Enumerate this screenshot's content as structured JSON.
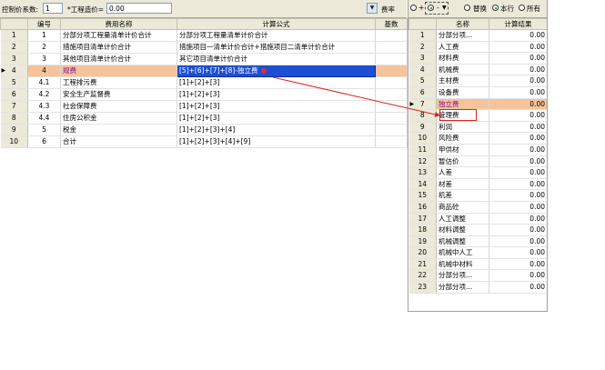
{
  "left_toolbar": {
    "coef_label": "控制价系数:",
    "coef_value": "1",
    "price_label": "*工程造价=",
    "price_value": "0.00",
    "rate_label": "费率"
  },
  "left_table": {
    "headers": [
      "",
      "编号",
      "费用名称",
      "计算公式",
      "基数"
    ],
    "rows": [
      {
        "row": "1",
        "code": "1",
        "name": "分部分项工程量清单计价合计",
        "formula": "分部分项工程量清单计价合计"
      },
      {
        "row": "2",
        "code": "2",
        "name": "措施项目清单计价合计",
        "formula": "措施项目一清单计价合计+措施项目二清单计价合计"
      },
      {
        "row": "3",
        "code": "3",
        "name": "其他项目清单计价合计",
        "formula": "其它项目清单计价合计"
      },
      {
        "row": "4",
        "code": "4",
        "name": "规费",
        "formula": "[5]+[6]+[7]+[8]-独立费"
      },
      {
        "row": "5",
        "code": "4.1",
        "name": "工程排污费",
        "formula": "[1]+[2]+[3]"
      },
      {
        "row": "6",
        "code": "4.2",
        "name": "安全生产监督费",
        "formula": "[1]+[2]+[3]"
      },
      {
        "row": "7",
        "code": "4.3",
        "name": "社会保障费",
        "formula": "[1]+[2]+[3]"
      },
      {
        "row": "8",
        "code": "4.4",
        "name": "住房公积金",
        "formula": "[1]+[2]+[3]"
      },
      {
        "row": "9",
        "code": "5",
        "name": "税金",
        "formula": "[1]+[2]+[3]+[4]"
      },
      {
        "row": "10",
        "code": "6",
        "name": "合计",
        "formula": "[1]+[2]+[3]+[4]+[9]"
      }
    ]
  },
  "right_toolbar": {
    "opt_plus": "+",
    "opt_minus": "-",
    "replace": "替换",
    "this_row": "本行",
    "all": "所有"
  },
  "right_table": {
    "headers": [
      "",
      "名称",
      "计算结果"
    ],
    "rows": [
      {
        "row": "1",
        "name": "分部分项...",
        "value": "0.00"
      },
      {
        "row": "2",
        "name": "人工费",
        "value": "0.00"
      },
      {
        "row": "3",
        "name": "材料费",
        "value": "0.00"
      },
      {
        "row": "4",
        "name": "机械费",
        "value": "0.00"
      },
      {
        "row": "5",
        "name": "主材费",
        "value": "0.00"
      },
      {
        "row": "6",
        "name": "设备费",
        "value": "0.00"
      },
      {
        "row": "7",
        "name": "独立费",
        "value": "0.00"
      },
      {
        "row": "8",
        "name": "管理费",
        "value": "0.00"
      },
      {
        "row": "9",
        "name": "利润",
        "value": "0.00"
      },
      {
        "row": "10",
        "name": "风险费",
        "value": "0.00"
      },
      {
        "row": "11",
        "name": "甲供材",
        "value": "0.00"
      },
      {
        "row": "12",
        "name": "暂估价",
        "value": "0.00"
      },
      {
        "row": "13",
        "name": "人差",
        "value": "0.00"
      },
      {
        "row": "14",
        "name": "材差",
        "value": "0.00"
      },
      {
        "row": "15",
        "name": "机差",
        "value": "0.00"
      },
      {
        "row": "16",
        "name": "商品砼",
        "value": "0.00"
      },
      {
        "row": "17",
        "name": "人工调整",
        "value": "0.00"
      },
      {
        "row": "18",
        "name": "材料调整",
        "value": "0.00"
      },
      {
        "row": "19",
        "name": "机械调整",
        "value": "0.00"
      },
      {
        "row": "20",
        "name": "机械中人工",
        "value": "0.00"
      },
      {
        "row": "21",
        "name": "机械中材料",
        "value": "0.00"
      },
      {
        "row": "22",
        "name": "分部分项...",
        "value": "0.00"
      },
      {
        "row": "23",
        "name": "分部分项...",
        "value": "0.00"
      }
    ]
  },
  "colors": {
    "selected_row": "#f6c39a",
    "formula_highlight": "#1c4fd3",
    "annotation": "#e02020"
  }
}
